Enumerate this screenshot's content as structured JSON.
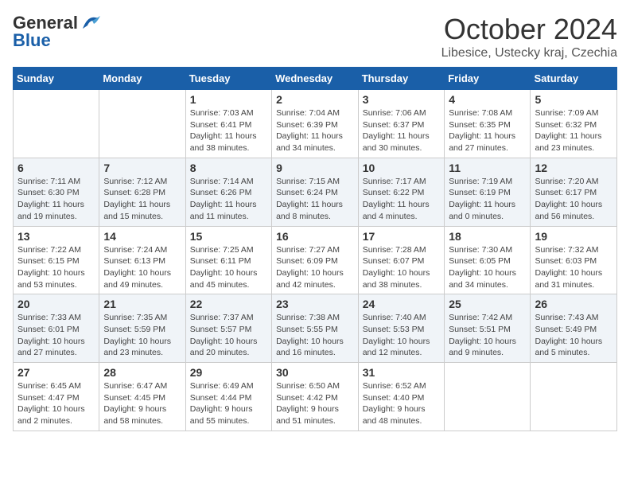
{
  "header": {
    "logo_general": "General",
    "logo_blue": "Blue",
    "month_title": "October 2024",
    "location": "Libesice, Ustecky kraj, Czechia"
  },
  "weekdays": [
    "Sunday",
    "Monday",
    "Tuesday",
    "Wednesday",
    "Thursday",
    "Friday",
    "Saturday"
  ],
  "weeks": [
    [
      {
        "day": "",
        "info": ""
      },
      {
        "day": "",
        "info": ""
      },
      {
        "day": "1",
        "info": "Sunrise: 7:03 AM\nSunset: 6:41 PM\nDaylight: 11 hours and 38 minutes."
      },
      {
        "day": "2",
        "info": "Sunrise: 7:04 AM\nSunset: 6:39 PM\nDaylight: 11 hours and 34 minutes."
      },
      {
        "day": "3",
        "info": "Sunrise: 7:06 AM\nSunset: 6:37 PM\nDaylight: 11 hours and 30 minutes."
      },
      {
        "day": "4",
        "info": "Sunrise: 7:08 AM\nSunset: 6:35 PM\nDaylight: 11 hours and 27 minutes."
      },
      {
        "day": "5",
        "info": "Sunrise: 7:09 AM\nSunset: 6:32 PM\nDaylight: 11 hours and 23 minutes."
      }
    ],
    [
      {
        "day": "6",
        "info": "Sunrise: 7:11 AM\nSunset: 6:30 PM\nDaylight: 11 hours and 19 minutes."
      },
      {
        "day": "7",
        "info": "Sunrise: 7:12 AM\nSunset: 6:28 PM\nDaylight: 11 hours and 15 minutes."
      },
      {
        "day": "8",
        "info": "Sunrise: 7:14 AM\nSunset: 6:26 PM\nDaylight: 11 hours and 11 minutes."
      },
      {
        "day": "9",
        "info": "Sunrise: 7:15 AM\nSunset: 6:24 PM\nDaylight: 11 hours and 8 minutes."
      },
      {
        "day": "10",
        "info": "Sunrise: 7:17 AM\nSunset: 6:22 PM\nDaylight: 11 hours and 4 minutes."
      },
      {
        "day": "11",
        "info": "Sunrise: 7:19 AM\nSunset: 6:19 PM\nDaylight: 11 hours and 0 minutes."
      },
      {
        "day": "12",
        "info": "Sunrise: 7:20 AM\nSunset: 6:17 PM\nDaylight: 10 hours and 56 minutes."
      }
    ],
    [
      {
        "day": "13",
        "info": "Sunrise: 7:22 AM\nSunset: 6:15 PM\nDaylight: 10 hours and 53 minutes."
      },
      {
        "day": "14",
        "info": "Sunrise: 7:24 AM\nSunset: 6:13 PM\nDaylight: 10 hours and 49 minutes."
      },
      {
        "day": "15",
        "info": "Sunrise: 7:25 AM\nSunset: 6:11 PM\nDaylight: 10 hours and 45 minutes."
      },
      {
        "day": "16",
        "info": "Sunrise: 7:27 AM\nSunset: 6:09 PM\nDaylight: 10 hours and 42 minutes."
      },
      {
        "day": "17",
        "info": "Sunrise: 7:28 AM\nSunset: 6:07 PM\nDaylight: 10 hours and 38 minutes."
      },
      {
        "day": "18",
        "info": "Sunrise: 7:30 AM\nSunset: 6:05 PM\nDaylight: 10 hours and 34 minutes."
      },
      {
        "day": "19",
        "info": "Sunrise: 7:32 AM\nSunset: 6:03 PM\nDaylight: 10 hours and 31 minutes."
      }
    ],
    [
      {
        "day": "20",
        "info": "Sunrise: 7:33 AM\nSunset: 6:01 PM\nDaylight: 10 hours and 27 minutes."
      },
      {
        "day": "21",
        "info": "Sunrise: 7:35 AM\nSunset: 5:59 PM\nDaylight: 10 hours and 23 minutes."
      },
      {
        "day": "22",
        "info": "Sunrise: 7:37 AM\nSunset: 5:57 PM\nDaylight: 10 hours and 20 minutes."
      },
      {
        "day": "23",
        "info": "Sunrise: 7:38 AM\nSunset: 5:55 PM\nDaylight: 10 hours and 16 minutes."
      },
      {
        "day": "24",
        "info": "Sunrise: 7:40 AM\nSunset: 5:53 PM\nDaylight: 10 hours and 12 minutes."
      },
      {
        "day": "25",
        "info": "Sunrise: 7:42 AM\nSunset: 5:51 PM\nDaylight: 10 hours and 9 minutes."
      },
      {
        "day": "26",
        "info": "Sunrise: 7:43 AM\nSunset: 5:49 PM\nDaylight: 10 hours and 5 minutes."
      }
    ],
    [
      {
        "day": "27",
        "info": "Sunrise: 6:45 AM\nSunset: 4:47 PM\nDaylight: 10 hours and 2 minutes."
      },
      {
        "day": "28",
        "info": "Sunrise: 6:47 AM\nSunset: 4:45 PM\nDaylight: 9 hours and 58 minutes."
      },
      {
        "day": "29",
        "info": "Sunrise: 6:49 AM\nSunset: 4:44 PM\nDaylight: 9 hours and 55 minutes."
      },
      {
        "day": "30",
        "info": "Sunrise: 6:50 AM\nSunset: 4:42 PM\nDaylight: 9 hours and 51 minutes."
      },
      {
        "day": "31",
        "info": "Sunrise: 6:52 AM\nSunset: 4:40 PM\nDaylight: 9 hours and 48 minutes."
      },
      {
        "day": "",
        "info": ""
      },
      {
        "day": "",
        "info": ""
      }
    ]
  ]
}
